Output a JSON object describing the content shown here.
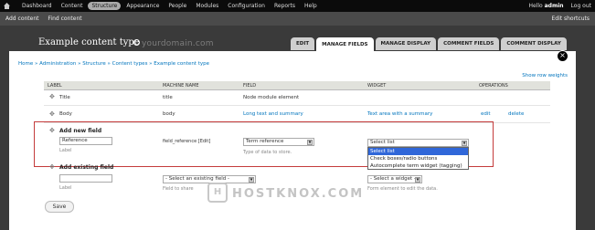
{
  "toolbar": {
    "menu": [
      "Dashboard",
      "Content",
      "Structure",
      "Appearance",
      "People",
      "Modules",
      "Configuration",
      "Reports",
      "Help"
    ],
    "active": "Structure",
    "hello_prefix": "Hello",
    "username": "admin",
    "logout": "Log out"
  },
  "shortcuts": {
    "links": [
      "Add content",
      "Find content"
    ],
    "edit": "Edit shortcuts"
  },
  "page": {
    "title": "Example content type",
    "watermark_text": "yourdomain.com",
    "tabs": [
      "EDIT",
      "MANAGE FIELDS",
      "MANAGE DISPLAY",
      "COMMENT FIELDS",
      "COMMENT DISPLAY"
    ],
    "active_tab": "MANAGE FIELDS",
    "close": "×"
  },
  "breadcrumb": "Home » Administration » Structure » Content types » Example content type",
  "show_row_weights": "Show row weights",
  "table": {
    "headers": [
      "LABEL",
      "MACHINE NAME",
      "FIELD",
      "WIDGET",
      "OPERATIONS"
    ],
    "rows": [
      {
        "label": "Title",
        "machine": "title",
        "field": "Node module element",
        "widget": "",
        "edit": "",
        "delete": ""
      },
      {
        "label": "Body",
        "machine": "body",
        "field": "Long text and summary",
        "widget": "Text area with a summary",
        "edit": "edit",
        "delete": "delete"
      }
    ]
  },
  "add_new": {
    "heading": "Add new field",
    "label_value": "Reference",
    "label_caption": "Label",
    "machine_value": "field_reference [Edit]",
    "field_type": "Term reference",
    "field_type_desc": "Type of data to store.",
    "widget_value": "Select list",
    "widget_options": [
      "Select list",
      "Check boxes/radio buttons",
      "Autocomplete term widget (tagging)"
    ]
  },
  "add_existing": {
    "heading": "Add existing field",
    "label_caption": "Label",
    "field_placeholder": "- Select an existing field -",
    "field_desc": "Field to share",
    "widget_placeholder": "- Select a widget -",
    "widget_desc": "Form element to edit the data."
  },
  "save_label": "Save",
  "watermark": "HOSTKNOX.COM",
  "watermark_icon_letter": "H"
}
